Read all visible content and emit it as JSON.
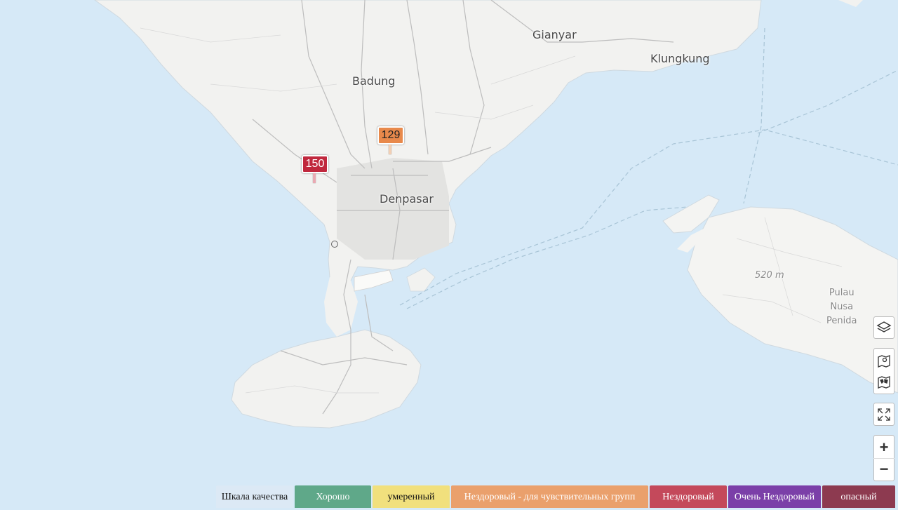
{
  "places": {
    "gianyar": "Gianyar",
    "klungkung": "Klungkung",
    "badung": "Badung",
    "denpasar": "Denpasar",
    "elevation": "520 m",
    "pulau": "Pulau",
    "nusa": "Nusa",
    "penida": "Penida"
  },
  "markers": [
    {
      "value": "129",
      "color": "#e8894b"
    },
    {
      "value": "150",
      "color": "#c0283d"
    }
  ],
  "controls": {
    "layers_icon": "layers-icon",
    "map_pin_icon": "map-pin-icon",
    "world_map_icon": "world-map-icon",
    "fullscreen_icon": "fullscreen-icon",
    "zoom_in": "+",
    "zoom_out": "−"
  },
  "legend": [
    {
      "label": "Шкала качества",
      "color": "#dce9f5"
    },
    {
      "label": "Хорошо",
      "color": "#5fa889"
    },
    {
      "label": "умеренный",
      "color": "#f1e07d"
    },
    {
      "label": "Нездоровый - для чувствительных групп",
      "color": "#eaa06c"
    },
    {
      "label": "Нездоровый",
      "color": "#c4495b"
    },
    {
      "label": "Очень Нездоровый",
      "color": "#7b3fa8"
    },
    {
      "label": "опасный",
      "color": "#8d3a50"
    }
  ]
}
